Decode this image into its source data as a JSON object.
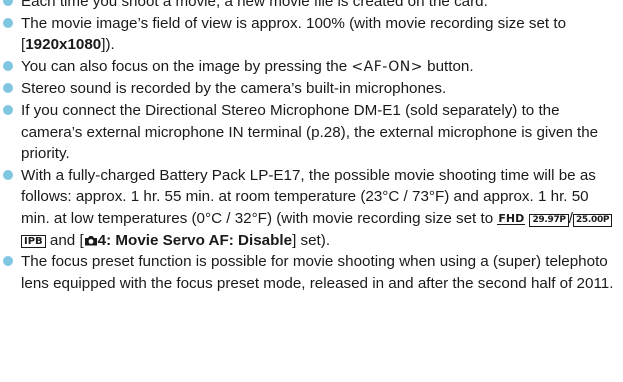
{
  "bullets": [
    {
      "text": "Each time you shoot a movie, a new movie file is created on the card."
    },
    {
      "before": "The movie image’s field of view is approx. 100% (with movie recording size set to [",
      "bold": "1920x1080",
      "after": "])."
    },
    {
      "before": "You can also focus on the image by pressing the ",
      "button": "<AF-ON>",
      "after": " button."
    },
    {
      "text": "Stereo sound is recorded by the camera’s built-in microphones."
    },
    {
      "text": "If you connect the Directional Stereo Microphone DM-E1 (sold separately) to the camera’s external microphone IN terminal (p.28), the external microphone is given the priority."
    },
    {
      "text1": "With a fully-charged Battery Pack LP-E17, the possible movie shooting time will be as follows: approx. 1 hr. 55 min. at room temperature (23°C / 73°F) and approx. 1 hr. 50 min. at low temperatures (0°C / 32°F) (with movie recording size set to ",
      "icon_fhd": "FHD",
      "icon_fps1": "29.97P",
      "slash": "/",
      "icon_fps2": "25.00P",
      "icon_ipb": "IPB",
      "text2": " and [",
      "bold_tab": "4: Movie Servo AF: Disable",
      "text3": "] set)."
    },
    {
      "text": "The focus preset function is possible for movie shooting when using a (super) telephoto lens equipped with the focus preset mode, released in and after the second half of 2011."
    }
  ],
  "colors": {
    "bullet": "#7fc6e3",
    "text": "#1a1a1a"
  },
  "icons": {
    "tab_icon": "camera-icon"
  }
}
